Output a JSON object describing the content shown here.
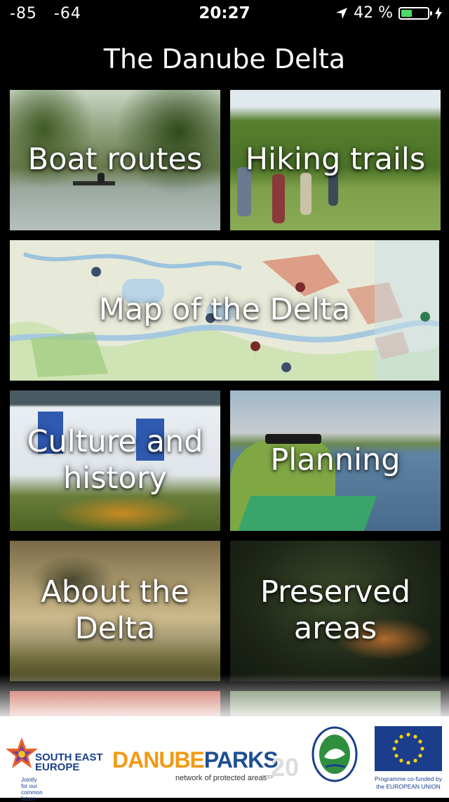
{
  "status": {
    "signal_left": "-85",
    "signal_right": "-64",
    "time": "20:27",
    "battery_percent": "42 %",
    "battery_level": 0.42
  },
  "header": {
    "title": "The Danube Delta"
  },
  "tiles": [
    {
      "label": "Boat routes"
    },
    {
      "label": "Hiking trails"
    },
    {
      "label": "Map of the Delta"
    },
    {
      "label": "Culture and history"
    },
    {
      "label": "Planning"
    },
    {
      "label": "About the Delta"
    },
    {
      "label": "Preserved areas"
    }
  ],
  "footer": {
    "see_name": "SOUTH EAST EUROPE",
    "see_tagline": "Jointly for our common future",
    "danubeparks_a": "DANUBE",
    "danubeparks_b": "PARKS",
    "danubeparks_sub": "network of protected areas",
    "danubeparks_step": "STEP",
    "danubeparks_num": "20",
    "eu_caption": "Programme co-funded by the EUROPEAN UNION"
  },
  "colors": {
    "accent_green": "#4cd964",
    "eu_blue": "#1a3e8c",
    "eu_yellow": "#ffd500"
  }
}
